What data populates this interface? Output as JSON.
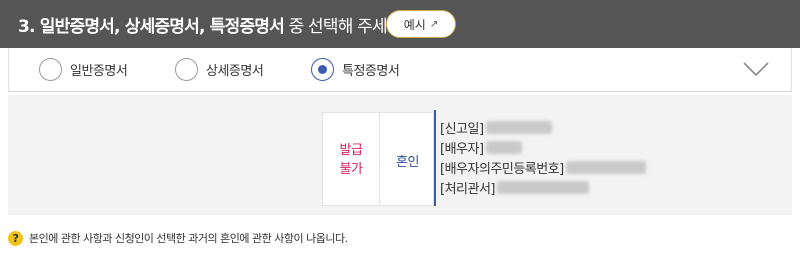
{
  "header": {
    "title_bold": "3. 일반증명서, 상세증명서, 특정증명서",
    "title_rest": " 중 선택해 주세요.",
    "example_label": "예시",
    "colors": {
      "bar": "#555555",
      "button_border": "#c9a84f"
    }
  },
  "options": [
    {
      "label": "일반증명서",
      "checked": false
    },
    {
      "label": "상세증명서",
      "checked": false
    },
    {
      "label": "특정증명서",
      "checked": true
    }
  ],
  "record": {
    "status_line1": "발급",
    "status_line2": "불가",
    "type": "혼인",
    "fields": [
      {
        "label": "[신고일]"
      },
      {
        "label": "[배우자]"
      },
      {
        "label": "[배우자의주민등록번호]"
      },
      {
        "label": "[처리관서]"
      }
    ],
    "colors": {
      "status": "#d6245c",
      "type": "#2d4f9a",
      "accent": "#3b5ab0"
    }
  },
  "notice": {
    "icon": "question-icon",
    "text": "본인에 관한 사항과 신청인이 선택한 과거의 혼인에 관한 사항이 나옵니다."
  }
}
